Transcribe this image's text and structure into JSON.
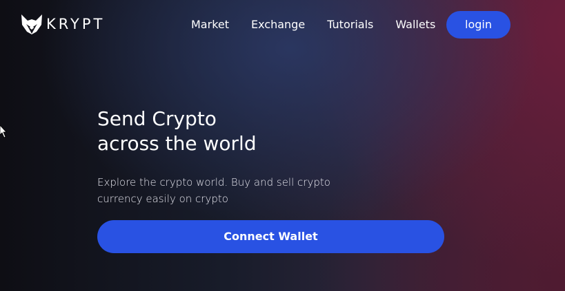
{
  "brand": {
    "name": "KRYPT",
    "logo_icon": "fox-head-icon"
  },
  "nav": {
    "links": [
      "Market",
      "Exchange",
      "Tutorials",
      "Wallets"
    ],
    "login_label": "login"
  },
  "hero": {
    "title_line1": "Send Crypto",
    "title_line2": "across the world",
    "desc_line1": "Explore the crypto world. Buy and sell crypto",
    "desc_line2": "currency easily on crypto",
    "connect_label": "Connect Wallet"
  },
  "colors": {
    "accent": "#2952e3",
    "text": "#ffffff",
    "background_left": "#0e0e14",
    "background_right": "#4a2036"
  }
}
